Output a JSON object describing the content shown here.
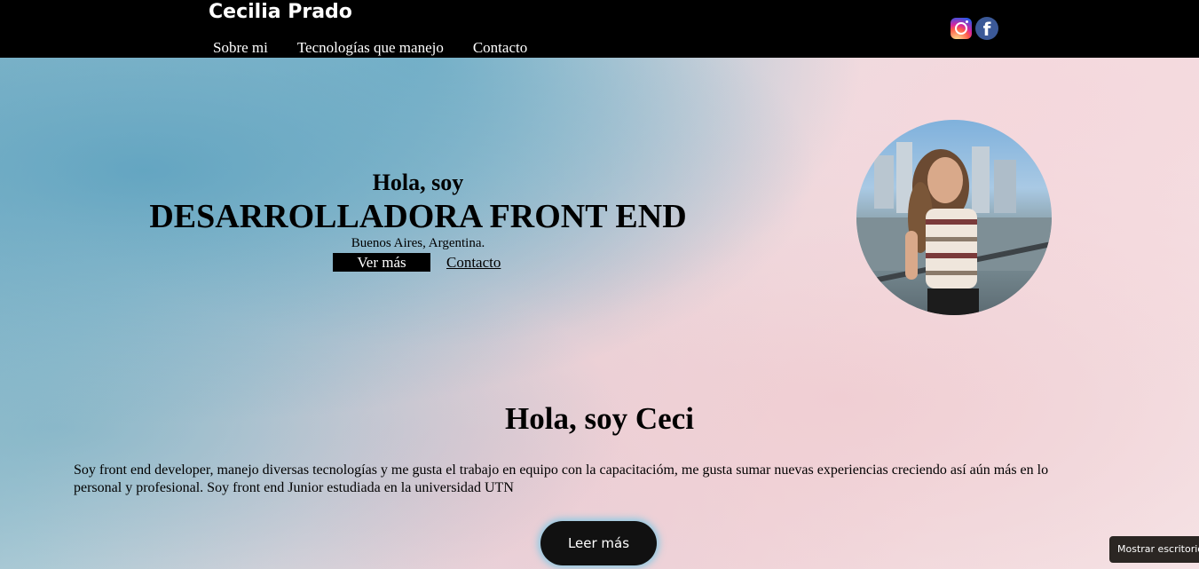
{
  "header": {
    "brand": "Cecilia Prado",
    "nav": [
      "Sobre mi",
      "Tecnologías que manejo",
      "Contacto"
    ],
    "social": [
      "instagram-icon",
      "facebook-icon"
    ],
    "facebook_glyph": "f"
  },
  "hero": {
    "greeting": "Hola, soy",
    "title": "DESARROLLADORA FRONT END",
    "location": "Buenos Aires, Argentina.",
    "primary_button": "Ver más",
    "secondary_link": "Contacto"
  },
  "about": {
    "title": "Hola, soy Ceci",
    "text": "Soy front end developer, manejo diversas tecnologías y me gusta el trabajo en equipo con la capacitacióm, me gusta sumar nuevas experiencias creciendo así aún más en lo personal y profesional. Soy front end Junior estudiada en la universidad UTN",
    "button": "Leer más"
  },
  "floating": {
    "desktop_toggle": "Mostrar escritorio"
  }
}
